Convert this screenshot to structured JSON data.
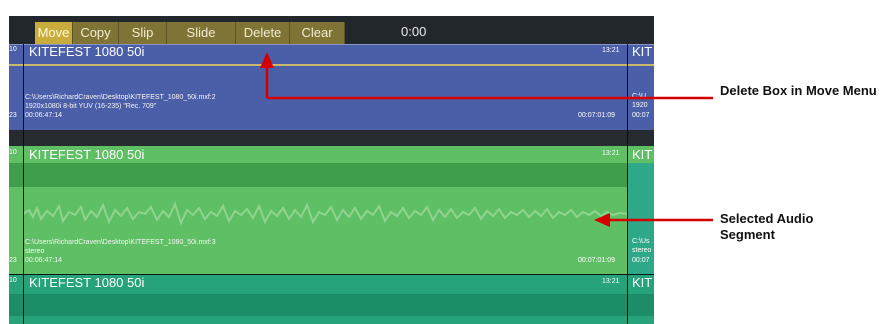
{
  "toolbar": {
    "buttons": [
      {
        "label": "Move",
        "active": true
      },
      {
        "label": "Copy",
        "active": false
      },
      {
        "label": "Slip",
        "active": false
      },
      {
        "label": "Slide",
        "active": false
      },
      {
        "label": "Delete",
        "active": false
      },
      {
        "label": "Clear",
        "active": false
      }
    ],
    "timecode": "0:00"
  },
  "video_track": {
    "track_number_top": "10",
    "clip_title": "KITEFEST 1080 50i",
    "duration": "13:21",
    "next_clip_title": "KIT",
    "path": "C:\\Users\\RichardCraven\\Desktop\\KITEFEST_1080_50i.mxf:2",
    "format": "1920x1080i 8-bit YUV (16-235) \"Rec. 709\"",
    "track_number_bottom": "23",
    "start_tc": "00:06:47:14",
    "end_tc": "00:07:01:09",
    "next_path": "C:\\U",
    "next_format": "1920",
    "next_tc": "00:07"
  },
  "audio_track": {
    "track_number_top": "10",
    "clip_title": "KITEFEST 1080 50i",
    "duration": "13:21",
    "next_clip_title": "KIT",
    "path": "C:\\Users\\RichardCraven\\Desktop\\KITEFEST_1080_50i.mxf:3",
    "format": "stereo",
    "track_number_bottom": "23",
    "start_tc": "00:06:47:14",
    "end_tc": "00:07:01:09",
    "next_path": "C:\\Us",
    "next_format": "stereo",
    "next_tc": "00:07"
  },
  "audio_track_2": {
    "track_number_top": "10",
    "clip_title": "KITEFEST 1080 50i",
    "duration": "13:21",
    "next_clip_title": "KIT"
  },
  "annotations": {
    "delete_box": "Delete Box in Move Menu",
    "selected_audio": "Selected Audio Segment"
  },
  "colors": {
    "video_clip": "#4b5fa8",
    "audio_selected": "#5fbf64",
    "audio_clip": "#26a37a",
    "toolbar_active": "#c9ad3c",
    "arrow": "#d40000"
  }
}
